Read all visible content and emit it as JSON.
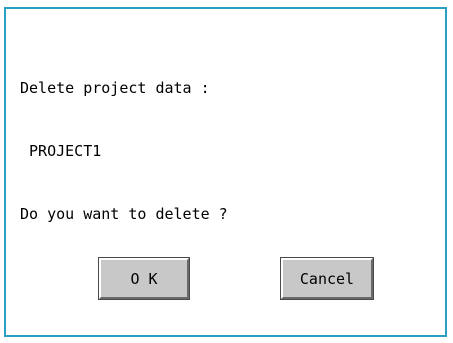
{
  "dialog": {
    "message_lines": [
      "Delete project data :",
      " PROJECT1",
      "Do you want to delete ?"
    ],
    "ok_label": "O K",
    "cancel_label": "Cancel"
  },
  "colors": {
    "border": "#2a9fc4",
    "button_face": "#c8c8c8",
    "background": "#ffffff"
  }
}
